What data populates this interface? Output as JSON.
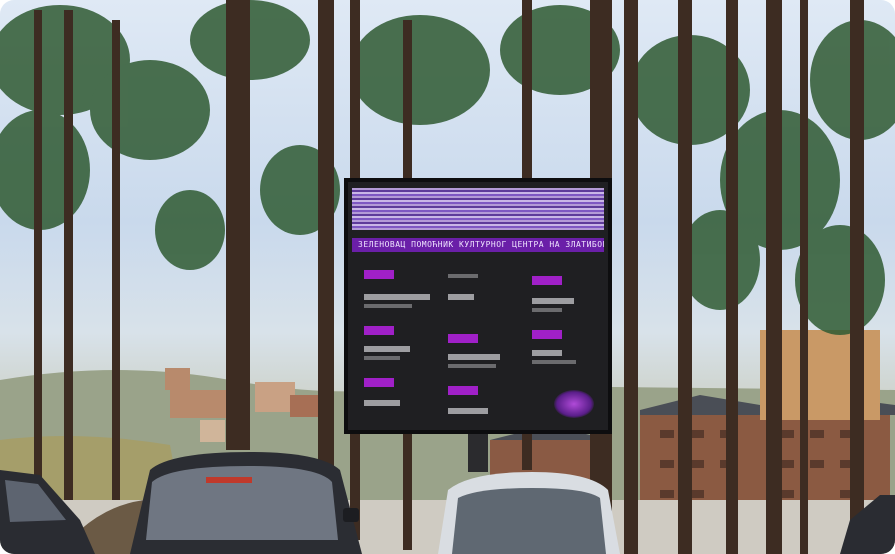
{
  "billboard": {
    "title_text": "ЗЕЛЕНОВАЦ ПОМОЋНИК КУЛТУРНОГ ЦЕНТРА НА ЗЛАТИБОРУ"
  },
  "colors": {
    "sky": "#d6e3f2",
    "tree_trunk": "#3a2a22",
    "pine_needles": "#2f5a32",
    "screen_bg": "#1f1f22",
    "screen_accent": "#a020c8",
    "car_dark": "#2b2d33",
    "car_white": "#d9dde2"
  }
}
